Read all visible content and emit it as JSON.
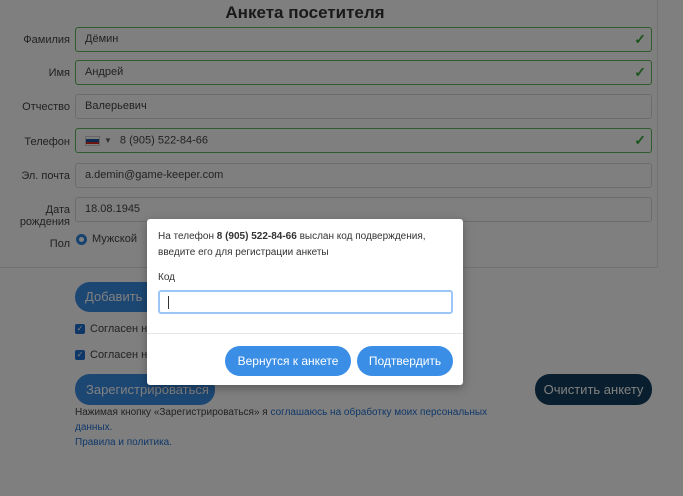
{
  "form": {
    "title": "Анкета посетителя",
    "surname": {
      "label": "Фамилия",
      "value": "Дёмин",
      "valid": true
    },
    "name": {
      "label": "Имя",
      "value": "Андрей",
      "valid": true
    },
    "patronymic": {
      "label": "Отчество",
      "value": "Валерьевич"
    },
    "phone": {
      "label": "Телефон",
      "value": "8 (905) 522-84-66",
      "valid": true
    },
    "email": {
      "label": "Эл. почта",
      "value": "a.demin@game-keeper.com"
    },
    "birthdate": {
      "label": "Дата рождения",
      "value": "18.08.1945"
    },
    "gender": {
      "label": "Пол",
      "option": "Мужской"
    },
    "add_button": "Добавить ребёнка",
    "consent1": "Согласен на",
    "consent2": "Согласен на",
    "register_button": "Зарегистрироваться",
    "clear_button": "Очистить анкету",
    "note_prefix": "Нажимая кнопку «Зарегистрироваться» я ",
    "note_link": "соглашаюсь на обработку моих персональных данных.",
    "rules_link": "Правила и политика."
  },
  "modal": {
    "msg_prefix": "На телефон ",
    "msg_phone": "8 (905) 522-84-66",
    "msg_suffix": " выслан код подверждения, введите его для регистрации анкеты",
    "code_label": "Код",
    "back_button": "Вернутся к анкете",
    "confirm_button": "Подтвердить"
  },
  "colors": {
    "accent": "#3a8ee6",
    "dark_button": "#123f5e",
    "valid": "#5cb85c"
  }
}
